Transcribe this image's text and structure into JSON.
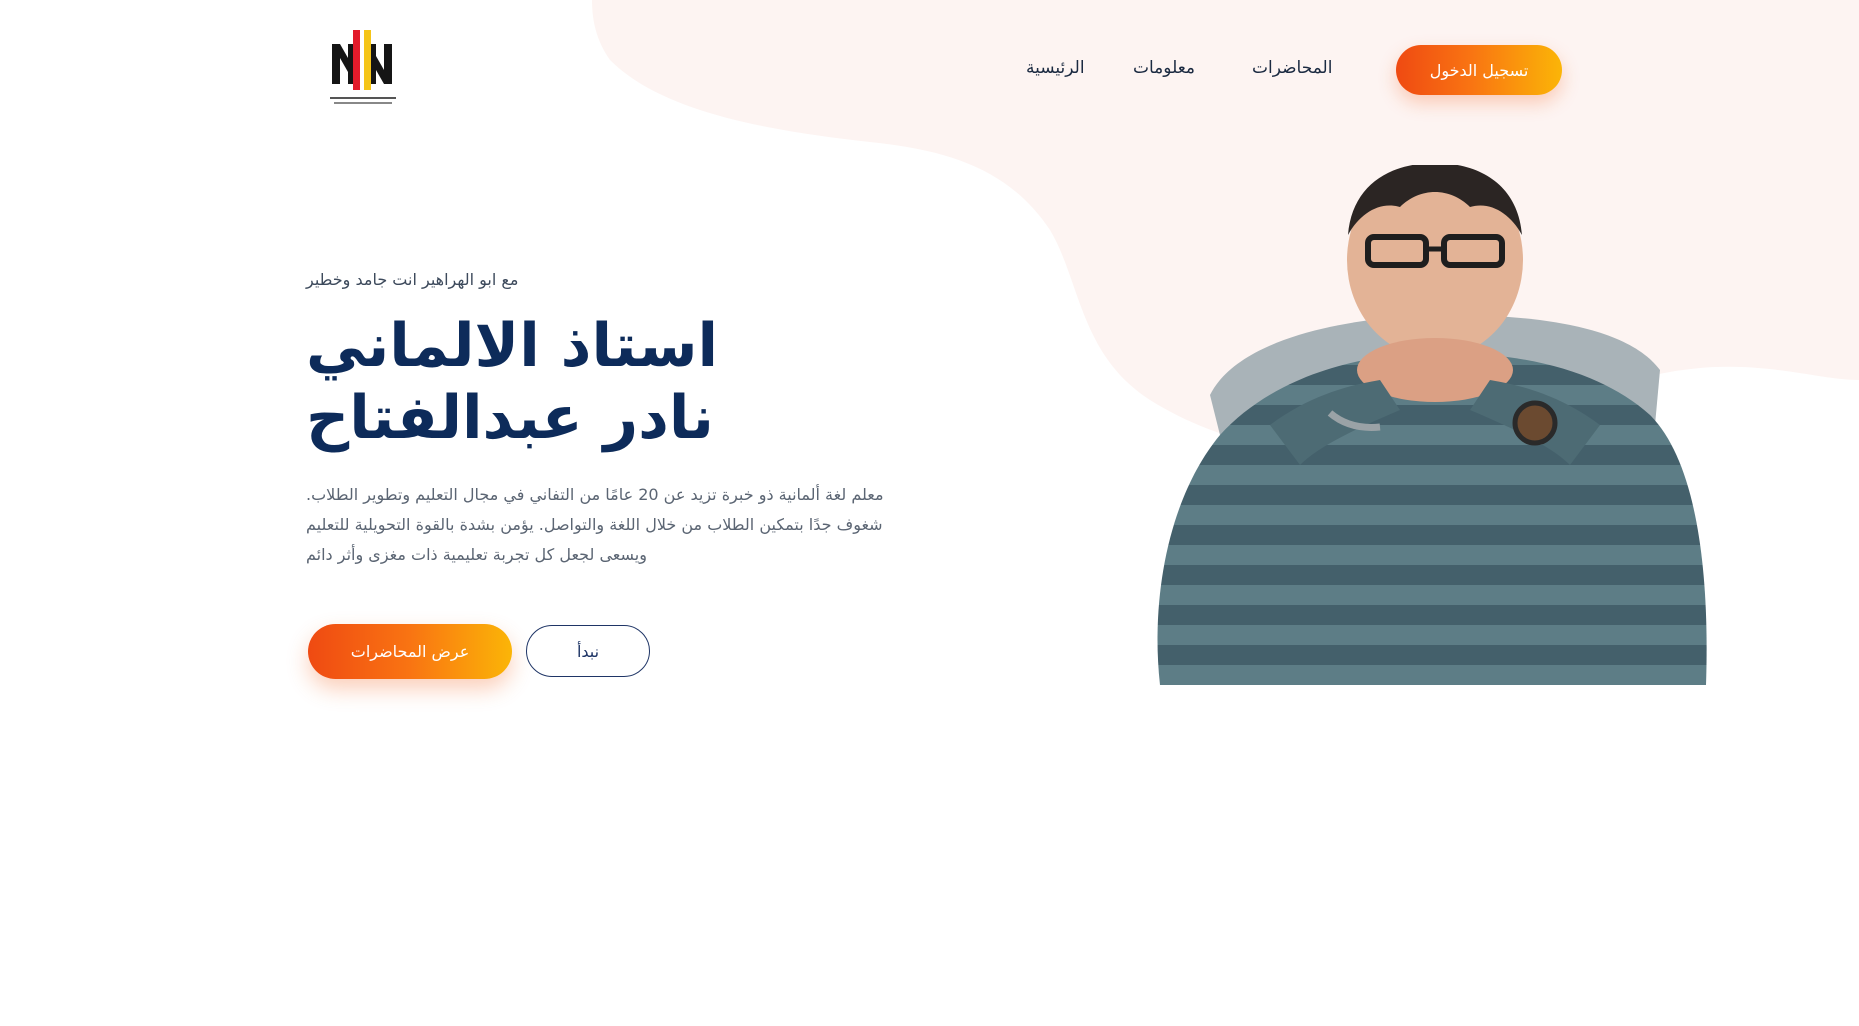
{
  "brand": {
    "logo_tagline": "مع ابو الهراهير انت جامد وخطير",
    "logo_icon": "logo-icon",
    "colors": {
      "navy": "#0d2b5a",
      "accent_start": "#ef4a12",
      "accent_end": "#fbb507",
      "blob": "#fdf4f2"
    }
  },
  "nav": {
    "items": [
      {
        "label": "الرئيسية"
      },
      {
        "label": "معلومات"
      },
      {
        "label": "المحاضرات"
      }
    ],
    "login_label": "تسجيل الدخول"
  },
  "hero": {
    "tagline": "مع ابو الهراهير انت جامد وخطير",
    "title_line1": "استاذ الالماني",
    "title_line2": "نادر عبدالفتاح",
    "description_lines": [
      "معلم لغة ألمانية ذو خبرة تزيد عن 20 عامًا من التفاني في مجال التعليم وتطوير الطلاب.",
      "شغوف جدًا بتمكين الطلاب من خلال اللغة والتواصل. يؤمن بشدة بالقوة التحويلية للتعليم",
      "ويسعى لجعل كل تجربة تعليمية ذات مغزى وأثر دائم"
    ],
    "primary_button": "عرض المحاضرات",
    "secondary_button": "نبدأ",
    "portrait_icon": "teacher-portrait"
  }
}
